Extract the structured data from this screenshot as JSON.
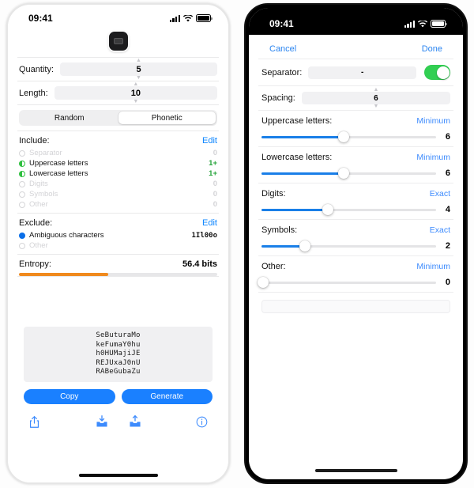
{
  "left": {
    "status": {
      "time": "09:41",
      "signal_icon": "cellular-bars-icon",
      "wifi_icon": "wifi-icon",
      "battery_icon": "battery-icon"
    },
    "app_icon_name": "app-icon",
    "quantity": {
      "label": "Quantity:",
      "value": "5"
    },
    "length": {
      "label": "Length:",
      "value": "10"
    },
    "segmented": {
      "options": [
        "Random",
        "Phonetic"
      ],
      "selected": "Phonetic"
    },
    "include": {
      "title": "Include:",
      "edit_label": "Edit",
      "items": [
        {
          "name": "Separator",
          "value": "0",
          "state": "off"
        },
        {
          "name": "Uppercase letters",
          "value": "1+",
          "state": "on"
        },
        {
          "name": "Lowercase letters",
          "value": "1+",
          "state": "on"
        },
        {
          "name": "Digits",
          "value": "0",
          "state": "off"
        },
        {
          "name": "Symbols",
          "value": "0",
          "state": "off"
        },
        {
          "name": "Other",
          "value": "0",
          "state": "off"
        }
      ]
    },
    "exclude": {
      "title": "Exclude:",
      "edit_label": "Edit",
      "items": [
        {
          "name": "Ambiguous characters",
          "value": "1Il00o",
          "state": "on-blue"
        },
        {
          "name": "Other",
          "value": "",
          "state": "off"
        }
      ]
    },
    "entropy": {
      "label": "Entropy:",
      "value": "56.4 bits",
      "percent": 45,
      "color": "#f08a1e"
    },
    "passwords": [
      "SeButuraMo",
      "keFumaY0hu",
      "h0HUMajiJE",
      "REJUxaJ0nU",
      "RABeGubaZu"
    ],
    "buttons": {
      "copy": "Copy",
      "generate": "Generate",
      "color": "#1a80ff"
    },
    "toolbar": [
      {
        "icon": "share-icon"
      },
      {
        "icon": "import-tray-down-icon"
      },
      {
        "icon": "export-tray-up-icon"
      },
      {
        "icon": "info-icon"
      }
    ]
  },
  "right": {
    "status": {
      "time": "09:41",
      "signal_icon": "cellular-bars-icon",
      "wifi_icon": "wifi-icon",
      "battery_icon": "battery-icon"
    },
    "nav": {
      "cancel": "Cancel",
      "done": "Done"
    },
    "separator": {
      "label": "Separator:",
      "value": "-",
      "toggle_on": true,
      "toggle_color": "#31cf52"
    },
    "spacing": {
      "label": "Spacing:",
      "value": "6"
    },
    "sliders": [
      {
        "label": "Uppercase letters:",
        "mode": "Minimum",
        "value": "6",
        "percent": 47
      },
      {
        "label": "Lowercase letters:",
        "mode": "Minimum",
        "value": "6",
        "percent": 47
      },
      {
        "label": "Digits:",
        "mode": "Exact",
        "value": "4",
        "percent": 38
      },
      {
        "label": "Symbols:",
        "mode": "Exact",
        "value": "2",
        "percent": 25
      },
      {
        "label": "Other:",
        "mode": "Minimum",
        "value": "0",
        "percent": 1
      }
    ]
  }
}
